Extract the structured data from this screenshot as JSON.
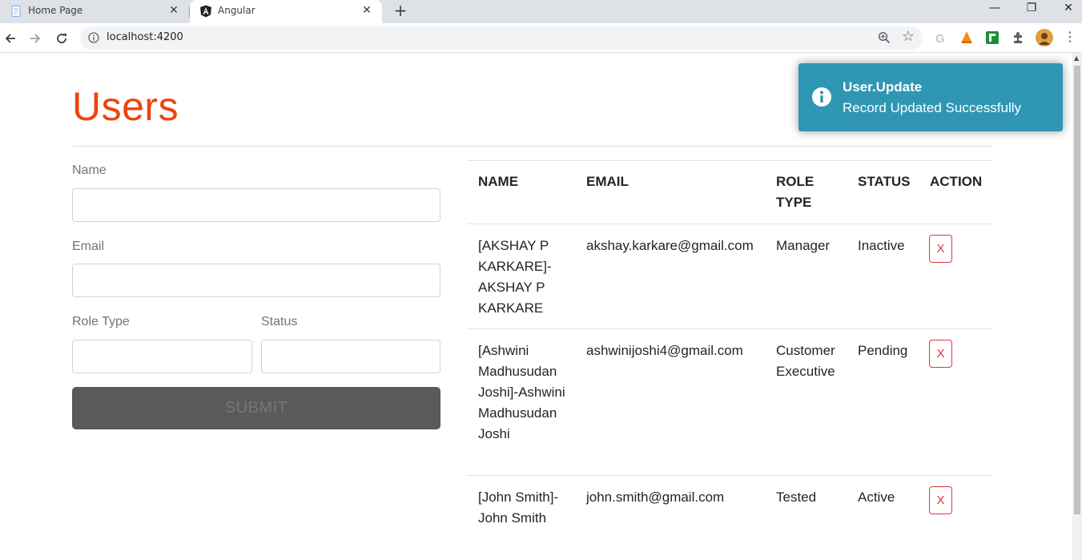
{
  "browser": {
    "tabs": [
      {
        "title": "Home Page",
        "active": false
      },
      {
        "title": "Angular",
        "active": true
      }
    ],
    "url": "localhost:4200"
  },
  "page": {
    "title": "Users",
    "form": {
      "name_label": "Name",
      "name_value": "",
      "email_label": "Email",
      "email_value": "",
      "role_label": "Role Type",
      "role_value": "",
      "status_label": "Status",
      "status_value": "",
      "submit_label": "SUBMIT"
    },
    "table": {
      "headers": [
        "NAME",
        "EMAIL",
        "ROLE TYPE",
        "STATUS",
        "ACTION"
      ],
      "rows": [
        {
          "name": "[AKSHAY P KARKARE]-AKSHAY P KARKARE",
          "email": "akshay.karkare@gmail.com",
          "role": "Manager",
          "status": "Inactive",
          "action": "X"
        },
        {
          "name": "[Ashwini Madhusudan Joshi]-Ashwini Madhusudan Joshi",
          "email": "ashwinijoshi4@gmail.com",
          "role": "Customer Executive",
          "status": "Pending",
          "action": "X"
        },
        {
          "name": "[John Smith]-John Smith",
          "email": "john.smith@gmail.com",
          "role": "Tested",
          "status": "Active",
          "action": "X"
        }
      ]
    }
  },
  "toast": {
    "title": "User.Update",
    "message": "Record Updated Successfully"
  },
  "colors": {
    "title": "#f0430d",
    "toast": "#2f96b4",
    "danger": "#dc3545",
    "submit": "#5a5a5a"
  },
  "icons": [
    "page-icon",
    "angular-icon",
    "close-icon",
    "plus-icon",
    "back-icon",
    "forward-icon",
    "reload-icon",
    "info-icon",
    "zoom-icon",
    "star-icon",
    "extensions-icon",
    "menu-icon"
  ]
}
